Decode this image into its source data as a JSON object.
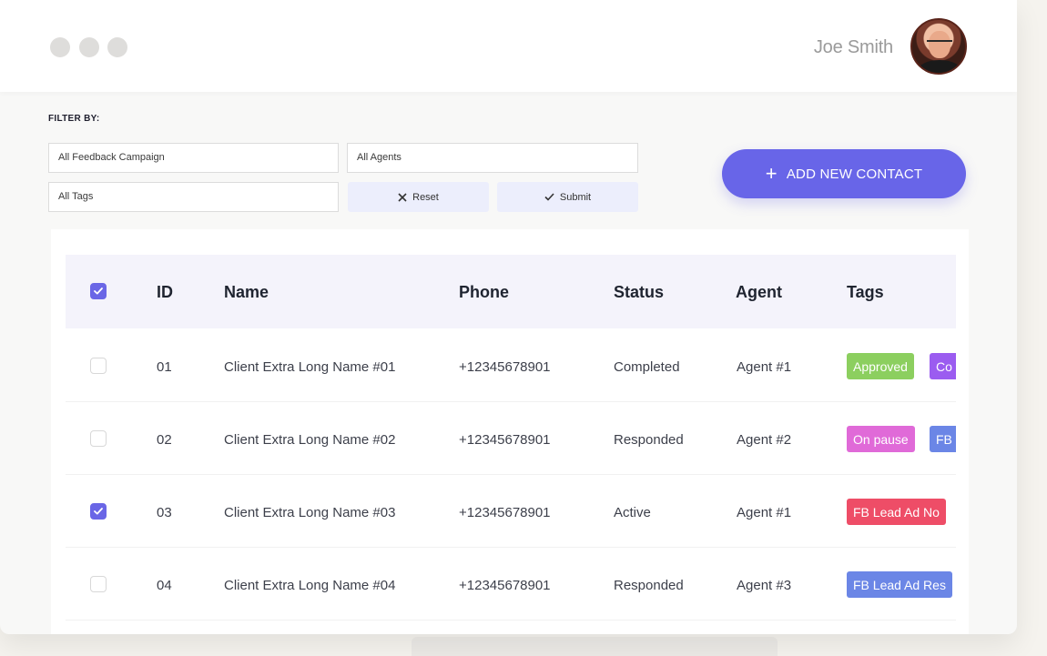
{
  "header": {
    "user_name": "Joe Smith"
  },
  "filters": {
    "label": "FILTER BY:",
    "campaign_value": "All Feedback Campaign",
    "agents_value": "All Agents",
    "tags_value": "All Tags",
    "reset_label": "Reset",
    "submit_label": "Submit"
  },
  "actions": {
    "add_contact_label": "ADD NEW CONTACT"
  },
  "table": {
    "header_checked": true,
    "columns": [
      "ID",
      "Name",
      "Phone",
      "Status",
      "Agent",
      "Tags"
    ],
    "rows": [
      {
        "checked": false,
        "id": "01",
        "name": "Client Extra Long Name #01",
        "phone": "+12345678901",
        "status": "Completed",
        "agent": "Agent #1",
        "tags": [
          {
            "label": "Approved",
            "color": "#8ccf5f"
          },
          {
            "label": "Co",
            "color": "#9b5cf0"
          }
        ]
      },
      {
        "checked": false,
        "id": "02",
        "name": "Client Extra Long Name #02",
        "phone": "+12345678901",
        "status": "Responded",
        "agent": "Agent #2",
        "tags": [
          {
            "label": "On pause",
            "color": "#e06ad8"
          },
          {
            "label": "FB",
            "color": "#6b86e6"
          }
        ]
      },
      {
        "checked": true,
        "id": "03",
        "name": "Client Extra Long Name #03",
        "phone": "+12345678901",
        "status": "Active",
        "agent": "Agent #1",
        "tags": [
          {
            "label": "FB Lead Ad No",
            "color": "#ee4d67"
          }
        ]
      },
      {
        "checked": false,
        "id": "04",
        "name": "Client Extra Long Name #04",
        "phone": "+12345678901",
        "status": "Responded",
        "agent": "Agent #3",
        "tags": [
          {
            "label": "FB Lead Ad Res",
            "color": "#6b86e6"
          }
        ]
      }
    ]
  },
  "colors": {
    "accent": "#6865e8",
    "check": "#6a66e6"
  }
}
